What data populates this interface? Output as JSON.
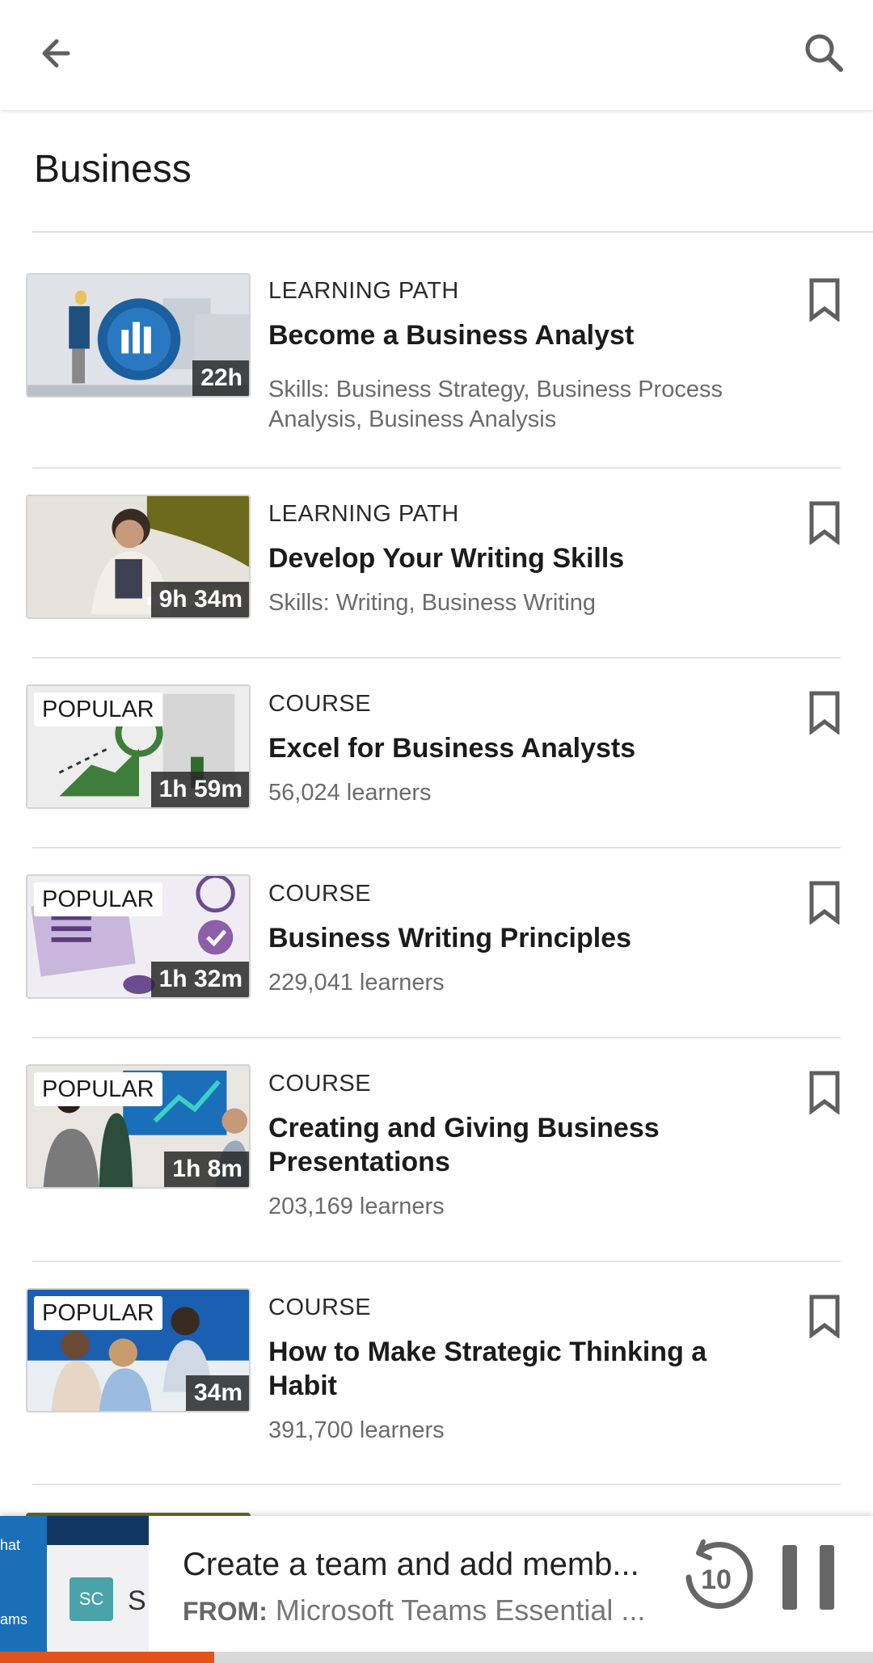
{
  "appbar": {
    "back_icon": "arrow-left-icon",
    "search_icon": "search-icon"
  },
  "page": {
    "title": "Business"
  },
  "items": [
    {
      "type": "LEARNING PATH",
      "title": "Become a Business Analyst",
      "meta": "Skills: Business Strategy, Business Process Analysis, Business Analysis",
      "duration": "22h",
      "badge": ""
    },
    {
      "type": "LEARNING PATH",
      "title": "Develop Your Writing Skills",
      "meta": "Skills: Writing, Business Writing",
      "duration": "9h 34m",
      "badge": ""
    },
    {
      "type": "COURSE",
      "title": "Excel for Business Analysts",
      "meta": "56,024 learners",
      "duration": "1h 59m",
      "badge": "POPULAR"
    },
    {
      "type": "COURSE",
      "title": "Business Writing Principles",
      "meta": "229,041 learners",
      "duration": "1h 32m",
      "badge": "POPULAR"
    },
    {
      "type": "COURSE",
      "title": "Creating and Giving Business Presentations",
      "meta": "203,169 learners",
      "duration": "1h 8m",
      "badge": "POPULAR"
    },
    {
      "type": "COURSE",
      "title": "How to Make Strategic Thinking a Habit",
      "meta": "391,700 learners",
      "duration": "34m",
      "badge": "POPULAR"
    }
  ],
  "player": {
    "title": "Create a team and add memb...",
    "from_label": "FROM:",
    "from_value": "Microsoft Teams Essential ...",
    "thumb_labels": {
      "chat": "hat",
      "teams": "ams",
      "avatar": "SC",
      "name": "S"
    },
    "rewind_label": "10",
    "rewind_icon": "rewind-10-icon",
    "pause_icon": "pause-icon",
    "progress": 0.245
  },
  "colors": {
    "accent": "#e0531c",
    "divider": "#e2e2e2",
    "muted": "#6b6b6b"
  }
}
